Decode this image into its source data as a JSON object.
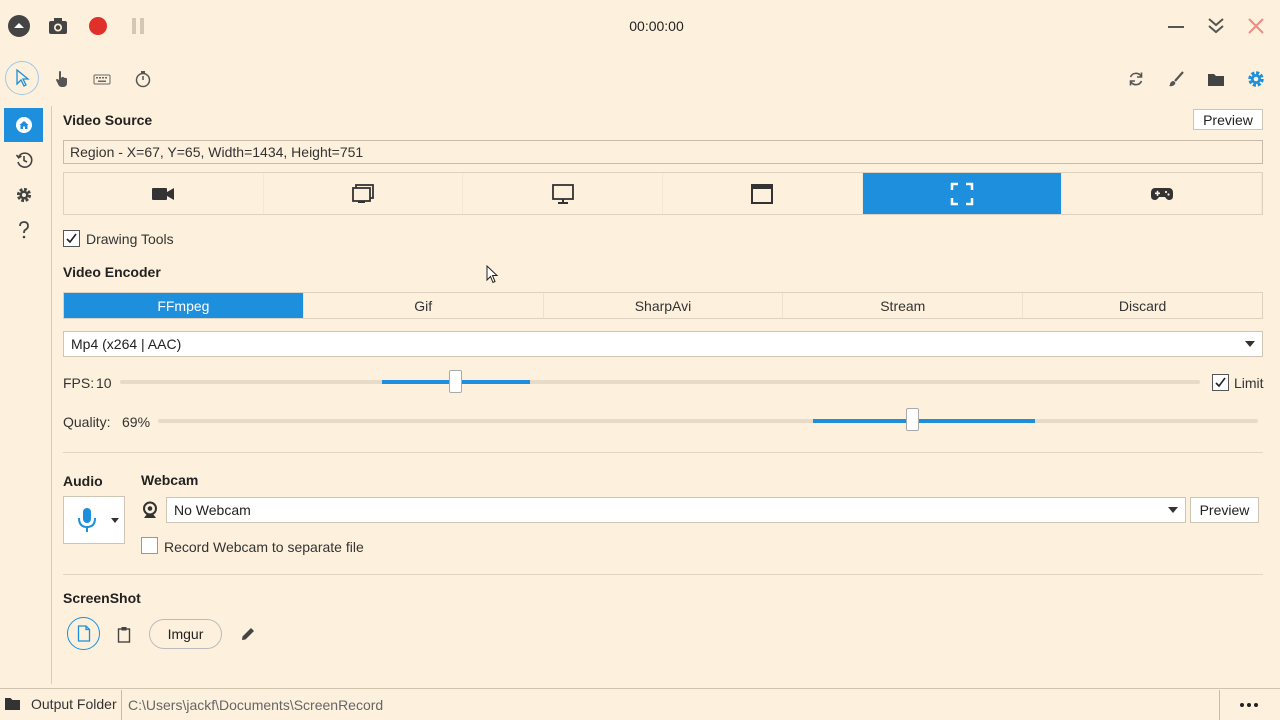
{
  "titlebar": {
    "timer": "00:00:00"
  },
  "video_source": {
    "title": "Video Source",
    "preview_label": "Preview",
    "region_text": "Region  -  X=67, Y=65, Width=1434, Height=751",
    "drawing_tools_label": "Drawing Tools"
  },
  "video_encoder": {
    "title": "Video Encoder",
    "tabs": [
      "FFmpeg",
      "Gif",
      "SharpAvi",
      "Stream",
      "Discard"
    ],
    "selected_tab": "FFmpeg",
    "format_value": "Mp4 (x264 | AAC)",
    "fps_label": "FPS:",
    "fps_value": "10",
    "limit_label": "Limit",
    "quality_label": "Quality:",
    "quality_value": "69%",
    "quality_fraction": 0.69
  },
  "audio": {
    "title": "Audio"
  },
  "webcam": {
    "title": "Webcam",
    "selected": "No Webcam",
    "preview_label": "Preview",
    "separate_file_label": "Record Webcam to separate file"
  },
  "screenshot": {
    "title": "ScreenShot",
    "imgur_label": "Imgur"
  },
  "output": {
    "label": "Output Folder",
    "path": "C:\\Users\\jackf\\Documents\\ScreenRecord"
  },
  "colors": {
    "accent": "#1d8fdc",
    "background": "#fdf1dd",
    "record_red": "#e0302a"
  }
}
